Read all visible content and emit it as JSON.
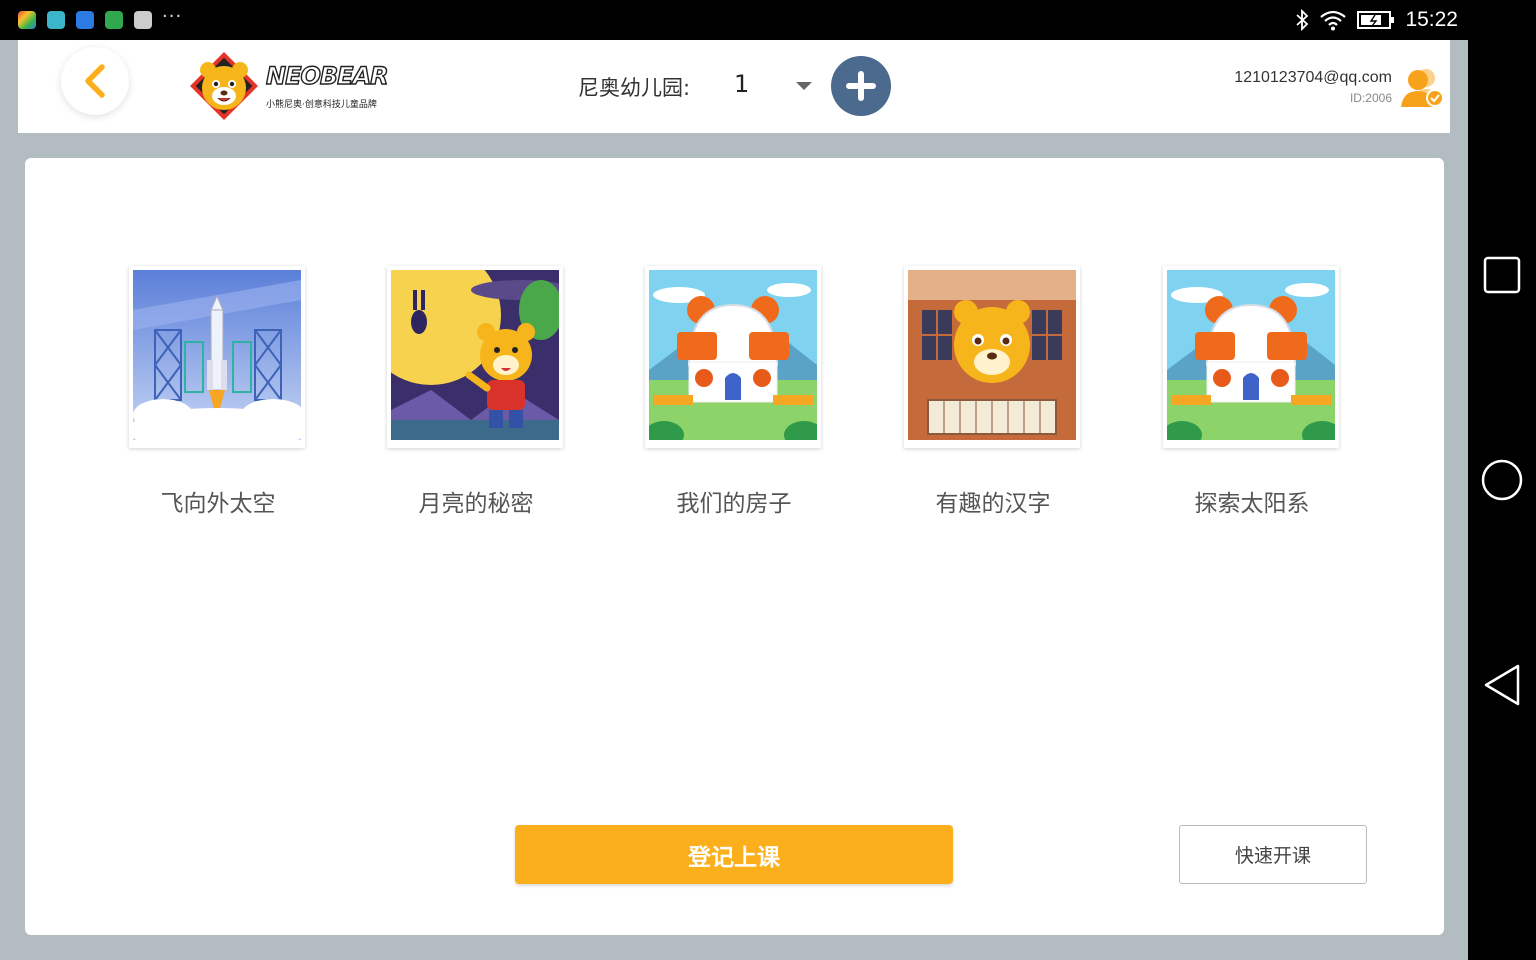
{
  "status_bar": {
    "time": "15:22",
    "notification_icons": [
      "photos-app-icon",
      "chat-app-icon",
      "security-app-icon",
      "game-app-icon",
      "keyboard-app-icon"
    ],
    "more": "···"
  },
  "header": {
    "logo": {
      "brand": "NEOBEAR",
      "tagline": "小熊尼奥·创意科技儿童品牌"
    },
    "school_label": "尼奥幼儿园:",
    "school_value": "1",
    "account_email": "1210123704@qq.com",
    "account_id": "ID:2006"
  },
  "courses": [
    {
      "title": "飞向外太空",
      "image": "rocket-launch"
    },
    {
      "title": "月亮的秘密",
      "image": "moon-bear"
    },
    {
      "title": "我们的房子",
      "image": "bear-house"
    },
    {
      "title": "有趣的汉字",
      "image": "bear-reading"
    },
    {
      "title": "探索太阳系",
      "image": "bear-house"
    }
  ],
  "actions": {
    "register": "登记上课",
    "quick_start": "快速开课"
  },
  "colors": {
    "accent": "#fbaf1d",
    "add_button": "#4b6a8d",
    "background": "#b3bcc1"
  }
}
